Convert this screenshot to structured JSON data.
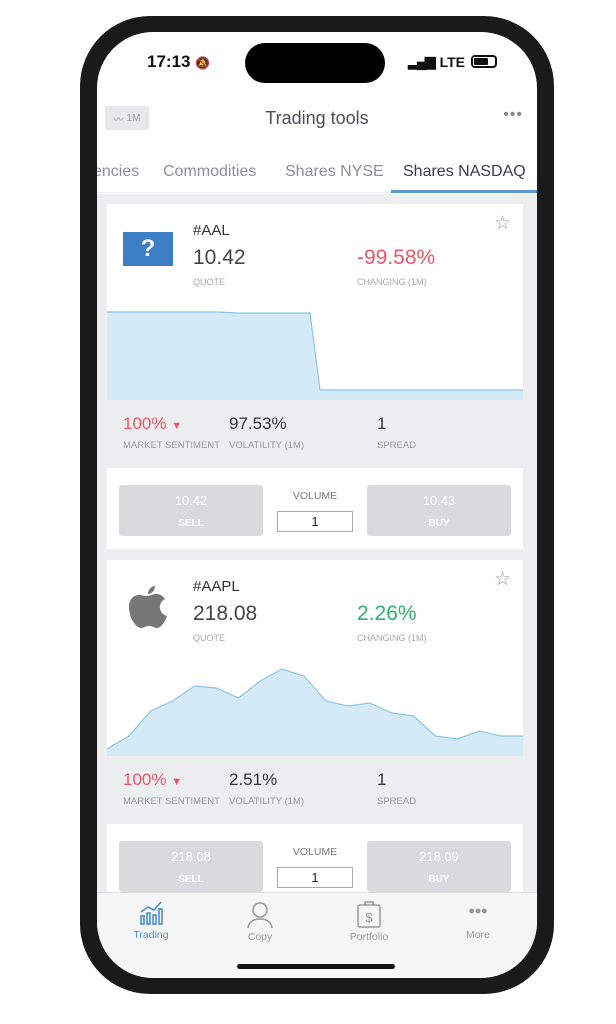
{
  "status": {
    "time": "17:13",
    "network": "LTE"
  },
  "header": {
    "period": "1M",
    "title": "Trading tools",
    "more": "•••"
  },
  "tabs": [
    {
      "label": "encies"
    },
    {
      "label": "Commodities"
    },
    {
      "label": "Shares NYSE"
    },
    {
      "label": "Shares NASDAQ",
      "active": true
    }
  ],
  "cards": [
    {
      "symbol": "#AAL",
      "logo": "?",
      "quote": "10.42",
      "quote_label": "QUOTE",
      "change": "-99.58%",
      "change_label": "CHANGING (1M)",
      "change_color": "#e8586a",
      "sparkline": [
        88,
        88,
        88,
        88,
        88,
        88,
        87,
        87,
        87,
        87,
        10,
        10,
        10,
        10,
        10,
        10,
        10,
        10,
        10,
        10
      ],
      "sentiment": "100%",
      "sentiment_label": "MARKET SENTIMENT",
      "volatility": "97.53%",
      "volatility_label": "VOLATILITY (1M)",
      "spread": "1",
      "spread_label": "SPREAD",
      "sell_price": "10.42",
      "sell_label": "SELL",
      "volume_label": "VOLUME",
      "volume": "1",
      "buy_price": "10.43",
      "buy_label": "BUY"
    },
    {
      "symbol": "#AAPL",
      "logo": "apple",
      "quote": "218.08",
      "quote_label": "QUOTE",
      "change": "2.26%",
      "change_label": "CHANGING (1M)",
      "change_color": "#2db36b",
      "sparkline": [
        7,
        20,
        45,
        55,
        70,
        68,
        58,
        75,
        87,
        80,
        55,
        50,
        53,
        43,
        40,
        20,
        17,
        25,
        20,
        20
      ],
      "sentiment": "100%",
      "sentiment_label": "MARKET SENTIMENT",
      "volatility": "2.51%",
      "volatility_label": "VOLATILITY (1M)",
      "spread": "1",
      "spread_label": "SPREAD",
      "sell_price": "218.08",
      "sell_label": "SELL",
      "volume_label": "VOLUME",
      "volume": "1",
      "buy_price": "218.09",
      "buy_label": "BUY"
    }
  ],
  "tabbar": [
    {
      "label": "Trading",
      "active": true
    },
    {
      "label": "Copy"
    },
    {
      "label": "Portfolio"
    },
    {
      "label": "More"
    }
  ],
  "colors": {
    "accent": "#4a90d0",
    "negative": "#e8586a",
    "positive": "#2db36b",
    "chart_fill": "#d4ebf7",
    "chart_line": "#8cc6e4"
  }
}
